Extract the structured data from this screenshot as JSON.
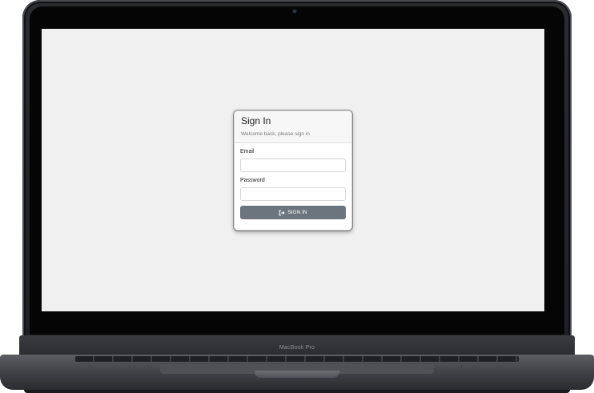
{
  "device": {
    "brand_label": "MacBook Pro"
  },
  "signin": {
    "title": "Sign In",
    "subtitle": "Welcome back, please sign in",
    "email_label": "Email",
    "email_value": "",
    "password_label": "Password",
    "password_value": "",
    "button_label": "SIGN IN",
    "button_icon": "sign-in-icon"
  },
  "colors": {
    "screen_background": "#f0f0f0",
    "button_background": "#6c757d",
    "button_text": "#ffffff"
  }
}
